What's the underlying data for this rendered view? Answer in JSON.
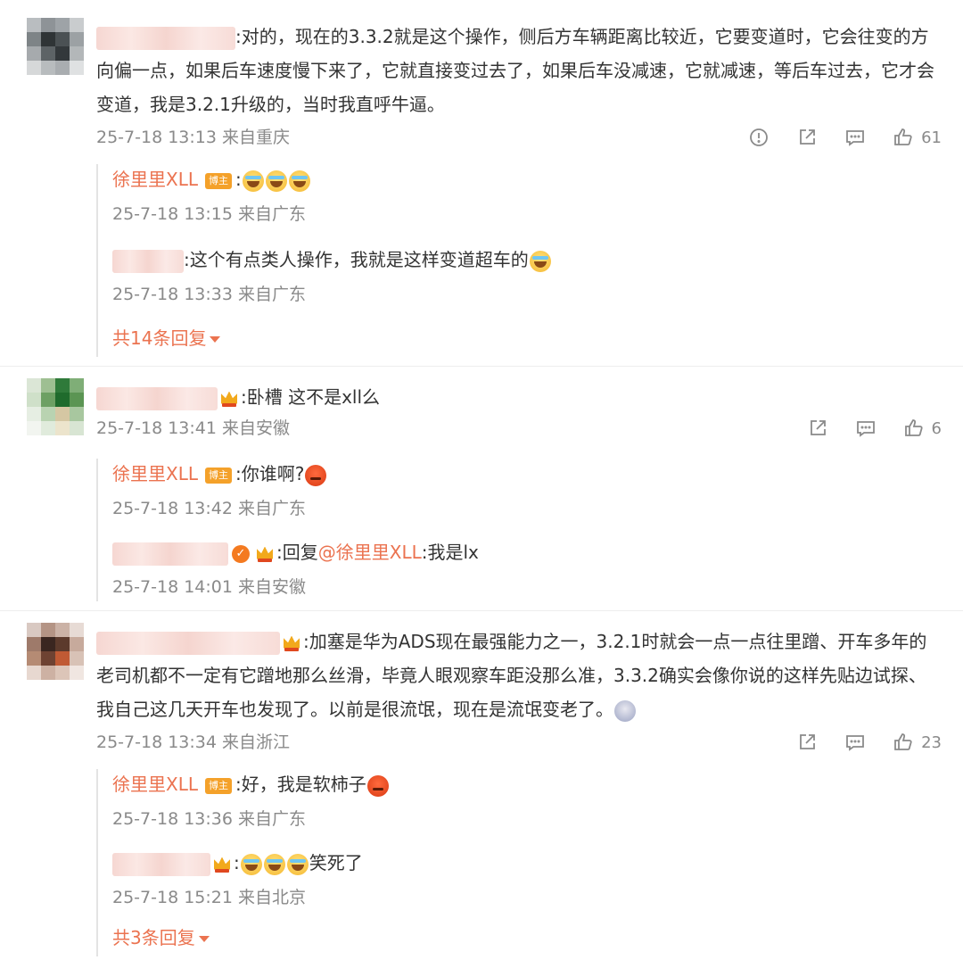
{
  "comments": [
    {
      "text": ":对的，现在的3.3.2就是这个操作，侧后方车辆距离比较近，它要变道时，它会往变的方向偏一点，如果后车速度慢下来了，它就直接变过去了，如果后车没减速，它就减速，等后车过去，它才会变道，我是3.2.1升级的，当时我直呼牛逼。",
      "time": "25-7-18 13:13 来自重庆",
      "likes": "61",
      "replies": [
        {
          "author": "徐里里XLL",
          "badge": "博主",
          "text": ":",
          "time": "25-7-18 13:15 来自广东"
        },
        {
          "text": ":这个有点类人操作，我就是这样变道超车的",
          "time": "25-7-18 13:33 来自广东"
        }
      ],
      "more": "共14条回复"
    },
    {
      "text": ":卧槽  这不是xll么",
      "time": "25-7-18 13:41 来自安徽",
      "likes": "6",
      "replies": [
        {
          "author": "徐里里XLL",
          "badge": "博主",
          "text": ":你谁啊?",
          "time": "25-7-18 13:42 来自广东"
        },
        {
          "prefix": ":回复",
          "mention": "@徐里里XLL",
          "text": ":我是lx",
          "time": "25-7-18 14:01 来自安徽"
        }
      ]
    },
    {
      "text": ":加塞是华为ADS现在最强能力之一，3.2.1时就会一点一点往里蹭、开车多年的老司机都不一定有它蹭地那么丝滑，毕竟人眼观察车距没那么准，3.3.2确实会像你说的这样先贴边试探、我自己这几天开车也发现了。以前是很流氓，现在是流氓变老了。",
      "time": "25-7-18 13:34 来自浙江",
      "likes": "23",
      "replies": [
        {
          "author": "徐里里XLL",
          "badge": "博主",
          "text": ":好，我是软柿子",
          "time": "25-7-18 13:36 来自广东"
        },
        {
          "text": ":",
          "suffix": "笑死了",
          "time": "25-7-18 15:21 来自北京"
        }
      ],
      "more": "共3条回复"
    }
  ],
  "icons": [
    "report-icon",
    "share-icon",
    "comment-icon",
    "like-icon"
  ],
  "colors": {
    "accent": "#eb7350",
    "meta": "#8a8a8a",
    "badge": "#f4a12a"
  }
}
